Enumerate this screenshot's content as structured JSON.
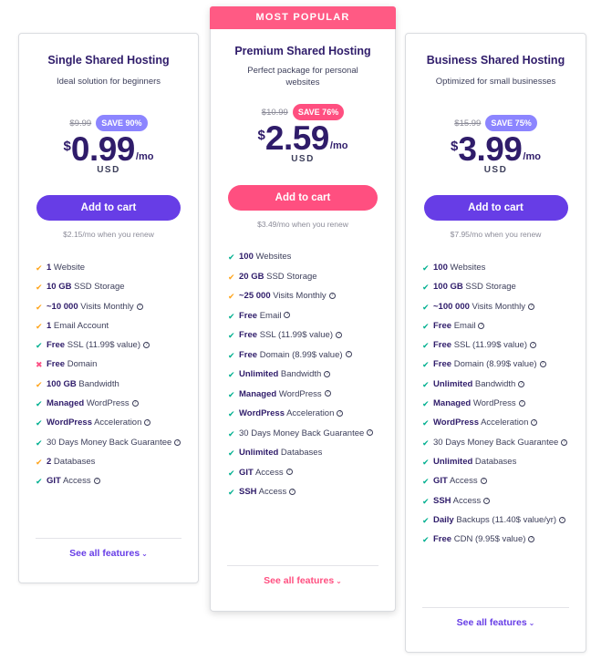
{
  "colors": {
    "purple": "#673de6",
    "purple_badge": "#8c85ff",
    "pink": "#ff4f80",
    "pink_ribbon": "#ff5a84",
    "check_green": "#00b090",
    "check_orange": "#ffa41b",
    "cross_red": "#fc5185",
    "heading": "#2f1c6a"
  },
  "icons": {
    "check": "✔",
    "cross": "✖",
    "help": "?",
    "chevron": "⌄"
  },
  "plans": [
    {
      "ribbon": null,
      "title": "Single Shared Hosting",
      "subtitle": "Ideal solution for beginners",
      "old_price": "$9.99",
      "save": "SAVE 90%",
      "currency": "$",
      "amount": "0.99",
      "per": "/mo",
      "usd": "USD",
      "cart_label": "Add to cart",
      "renew": "$2.15/mo when you renew",
      "see_all": "See all features",
      "features": [
        {
          "icon": "check",
          "status": "partial",
          "bold": "1",
          "text": " Website",
          "help": false
        },
        {
          "icon": "check",
          "status": "partial",
          "bold": "10 GB",
          "text": " SSD Storage",
          "help": false
        },
        {
          "icon": "check",
          "status": "partial",
          "bold": "~10 000",
          "text": " Visits Monthly",
          "help": true
        },
        {
          "icon": "check",
          "status": "partial",
          "bold": "1",
          "text": " Email Account",
          "help": false
        },
        {
          "icon": "check",
          "status": "full",
          "bold": "Free",
          "text": " SSL (11.99$ value)",
          "help": true
        },
        {
          "icon": "cross",
          "status": "none",
          "bold": "Free",
          "text": " Domain",
          "help": false
        },
        {
          "icon": "check",
          "status": "partial",
          "bold": "100 GB",
          "text": " Bandwidth",
          "help": false
        },
        {
          "icon": "check",
          "status": "full",
          "bold": "Managed",
          "text": " WordPress",
          "help": true
        },
        {
          "icon": "check",
          "status": "full",
          "bold": "WordPress",
          "text": " Acceleration",
          "help": true
        },
        {
          "icon": "check",
          "status": "full",
          "bold": "",
          "text": "30 Days Money Back Guarantee",
          "help": true
        },
        {
          "icon": "check",
          "status": "partial",
          "bold": "2",
          "text": " Databases",
          "help": false
        },
        {
          "icon": "check",
          "status": "full",
          "bold": "GIT",
          "text": " Access",
          "help": true
        }
      ]
    },
    {
      "ribbon": "MOST POPULAR",
      "title": "Premium Shared Hosting",
      "subtitle": "Perfect package for personal websites",
      "old_price": "$10.99",
      "save": "SAVE 76%",
      "currency": "$",
      "amount": "2.59",
      "per": "/mo",
      "usd": "USD",
      "cart_label": "Add to cart",
      "renew": "$3.49/mo when you renew",
      "see_all": "See all features",
      "features": [
        {
          "icon": "check",
          "status": "full",
          "bold": "100",
          "text": " Websites",
          "help": false
        },
        {
          "icon": "check",
          "status": "partial",
          "bold": "20 GB",
          "text": " SSD Storage",
          "help": false
        },
        {
          "icon": "check",
          "status": "partial",
          "bold": "~25 000",
          "text": " Visits Monthly",
          "help": true
        },
        {
          "icon": "check",
          "status": "full",
          "bold": "Free",
          "text": " Email",
          "help": true
        },
        {
          "icon": "check",
          "status": "full",
          "bold": "Free",
          "text": " SSL (11.99$ value)",
          "help": true
        },
        {
          "icon": "check",
          "status": "full",
          "bold": "Free",
          "text": " Domain (8.99$ value)",
          "help": true
        },
        {
          "icon": "check",
          "status": "full",
          "bold": "Unlimited",
          "text": " Bandwidth",
          "help": true
        },
        {
          "icon": "check",
          "status": "full",
          "bold": "Managed",
          "text": " WordPress",
          "help": true
        },
        {
          "icon": "check",
          "status": "full",
          "bold": "WordPress",
          "text": " Acceleration",
          "help": true
        },
        {
          "icon": "check",
          "status": "full",
          "bold": "",
          "text": "30 Days Money Back Guarantee",
          "help": true
        },
        {
          "icon": "check",
          "status": "full",
          "bold": "Unlimited",
          "text": " Databases",
          "help": false
        },
        {
          "icon": "check",
          "status": "full",
          "bold": "GIT",
          "text": " Access",
          "help": true
        },
        {
          "icon": "check",
          "status": "full",
          "bold": "SSH",
          "text": " Access",
          "help": true
        }
      ]
    },
    {
      "ribbon": null,
      "title": "Business Shared Hosting",
      "subtitle": "Optimized for small businesses",
      "old_price": "$15.99",
      "save": "SAVE 75%",
      "currency": "$",
      "amount": "3.99",
      "per": "/mo",
      "usd": "USD",
      "cart_label": "Add to cart",
      "renew": "$7.95/mo when you renew",
      "see_all": "See all features",
      "features": [
        {
          "icon": "check",
          "status": "full",
          "bold": "100",
          "text": " Websites",
          "help": false
        },
        {
          "icon": "check",
          "status": "full",
          "bold": "100 GB",
          "text": " SSD Storage",
          "help": false
        },
        {
          "icon": "check",
          "status": "full",
          "bold": "~100 000",
          "text": " Visits Monthly",
          "help": true
        },
        {
          "icon": "check",
          "status": "full",
          "bold": "Free",
          "text": " Email",
          "help": true
        },
        {
          "icon": "check",
          "status": "full",
          "bold": "Free",
          "text": " SSL (11.99$ value)",
          "help": true
        },
        {
          "icon": "check",
          "status": "full",
          "bold": "Free",
          "text": " Domain (8.99$ value)",
          "help": true
        },
        {
          "icon": "check",
          "status": "full",
          "bold": "Unlimited",
          "text": " Bandwidth",
          "help": true
        },
        {
          "icon": "check",
          "status": "full",
          "bold": "Managed",
          "text": " WordPress",
          "help": true
        },
        {
          "icon": "check",
          "status": "full",
          "bold": "WordPress",
          "text": " Acceleration",
          "help": true
        },
        {
          "icon": "check",
          "status": "full",
          "bold": "",
          "text": "30 Days Money Back Guarantee",
          "help": true
        },
        {
          "icon": "check",
          "status": "full",
          "bold": "Unlimited",
          "text": " Databases",
          "help": false
        },
        {
          "icon": "check",
          "status": "full",
          "bold": "GIT",
          "text": " Access",
          "help": true
        },
        {
          "icon": "check",
          "status": "full",
          "bold": "SSH",
          "text": " Access",
          "help": true
        },
        {
          "icon": "check",
          "status": "full",
          "bold": "Daily",
          "text": " Backups (11.40$ value/yr)",
          "help": true
        },
        {
          "icon": "check",
          "status": "full",
          "bold": "Free",
          "text": " CDN (9.95$ value)",
          "help": true
        }
      ]
    }
  ]
}
